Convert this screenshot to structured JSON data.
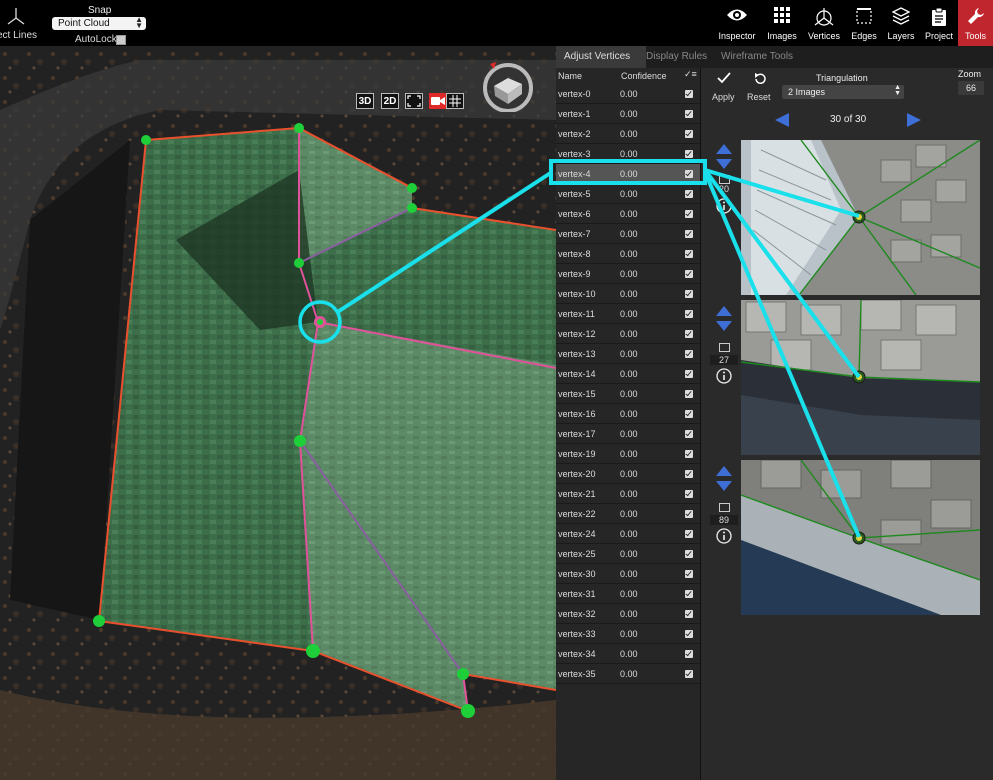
{
  "toolbar": {
    "left_tool_label": "ect Lines",
    "snap_label": "Snap",
    "snap_value": "Point Cloud",
    "autolock_label": "AutoLock",
    "tools": [
      {
        "id": "inspector",
        "label": "Inspector",
        "icon": "eye-icon"
      },
      {
        "id": "images",
        "label": "Images",
        "icon": "grid-icon"
      },
      {
        "id": "vertices",
        "label": "Vertices",
        "icon": "vertices-icon"
      },
      {
        "id": "edges",
        "label": "Edges",
        "icon": "edges-icon"
      },
      {
        "id": "layers",
        "label": "Layers",
        "icon": "layers-icon"
      },
      {
        "id": "project",
        "label": "Project",
        "icon": "clipboard-icon"
      },
      {
        "id": "tools",
        "label": "Tools",
        "icon": "wrench-icon",
        "active": true
      }
    ],
    "active_color": "#c0262d"
  },
  "viewport": {
    "btn_3d": "3D",
    "btn_2d": "2D",
    "highlight_color": "#19e0ea",
    "vertex_color": "#1fcf3a",
    "edge_color": "#e9502d",
    "ridge_color": "#e0529a"
  },
  "panel": {
    "tabs": [
      "Adjust Vertices",
      "Display Rules",
      "Wireframe Tools"
    ],
    "active_tab": 0,
    "columns": {
      "name": "Name",
      "confidence": "Confidence"
    },
    "vertices": [
      {
        "name": "vertex-0",
        "confidence": "0.00"
      },
      {
        "name": "vertex-1",
        "confidence": "0.00"
      },
      {
        "name": "vertex-2",
        "confidence": "0.00"
      },
      {
        "name": "vertex-3",
        "confidence": "0.00"
      },
      {
        "name": "vertex-4",
        "confidence": "0.00",
        "selected": true
      },
      {
        "name": "vertex-5",
        "confidence": "0.00"
      },
      {
        "name": "vertex-6",
        "confidence": "0.00"
      },
      {
        "name": "vertex-7",
        "confidence": "0.00"
      },
      {
        "name": "vertex-8",
        "confidence": "0.00"
      },
      {
        "name": "vertex-9",
        "confidence": "0.00"
      },
      {
        "name": "vertex-10",
        "confidence": "0.00"
      },
      {
        "name": "vertex-11",
        "confidence": "0.00"
      },
      {
        "name": "vertex-12",
        "confidence": "0.00"
      },
      {
        "name": "vertex-13",
        "confidence": "0.00"
      },
      {
        "name": "vertex-14",
        "confidence": "0.00"
      },
      {
        "name": "vertex-15",
        "confidence": "0.00"
      },
      {
        "name": "vertex-16",
        "confidence": "0.00"
      },
      {
        "name": "vertex-17",
        "confidence": "0.00"
      },
      {
        "name": "vertex-19",
        "confidence": "0.00"
      },
      {
        "name": "vertex-20",
        "confidence": "0.00"
      },
      {
        "name": "vertex-21",
        "confidence": "0.00"
      },
      {
        "name": "vertex-22",
        "confidence": "0.00"
      },
      {
        "name": "vertex-24",
        "confidence": "0.00"
      },
      {
        "name": "vertex-25",
        "confidence": "0.00"
      },
      {
        "name": "vertex-30",
        "confidence": "0.00"
      },
      {
        "name": "vertex-31",
        "confidence": "0.00"
      },
      {
        "name": "vertex-32",
        "confidence": "0.00"
      },
      {
        "name": "vertex-33",
        "confidence": "0.00"
      },
      {
        "name": "vertex-34",
        "confidence": "0.00"
      },
      {
        "name": "vertex-35",
        "confidence": "0.00"
      }
    ],
    "apply_label": "Apply",
    "reset_label": "Reset",
    "triangulation_label": "Triangulation",
    "triangulation_value": "2 Images",
    "zoom_label": "Zoom",
    "zoom_value": "66",
    "image_counter": "30 of 30",
    "images": [
      {
        "index": "20"
      },
      {
        "index": "27"
      },
      {
        "index": "89"
      }
    ]
  }
}
